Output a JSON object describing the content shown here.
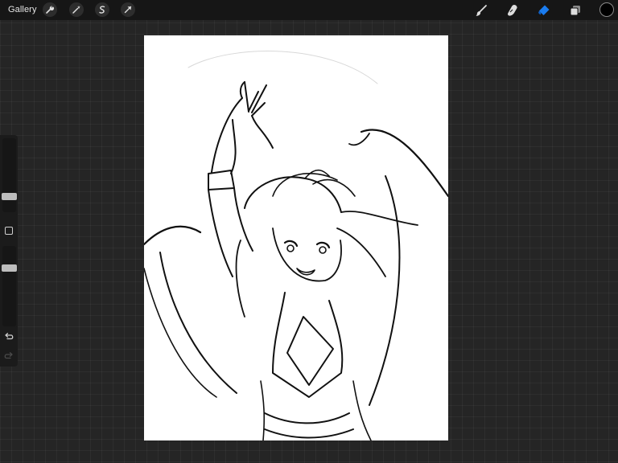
{
  "topbar": {
    "gallery_label": "Gallery",
    "left_tools": [
      {
        "icon": "wrench-icon",
        "name": "actions-button"
      },
      {
        "icon": "magic-wand-icon",
        "name": "adjustments-button"
      },
      {
        "icon": "selection-s-icon",
        "name": "selection-button"
      },
      {
        "icon": "transform-arrow-icon",
        "name": "transform-button"
      }
    ],
    "right_tools": [
      {
        "icon": "brush-icon",
        "name": "brush-tool-button",
        "active": false
      },
      {
        "icon": "smudge-icon",
        "name": "smudge-tool-button",
        "active": false
      },
      {
        "icon": "eraser-icon",
        "name": "eraser-tool-button",
        "active": true
      },
      {
        "icon": "layers-icon",
        "name": "layers-button",
        "active": false
      }
    ],
    "current_color": "#000000",
    "active_color": "#1a7cf0"
  },
  "sidebar": {
    "brush_size_level": 0.5,
    "opacity_level": 0.75,
    "modify_icon": "square-icon",
    "undo_icon": "undo-icon",
    "redo_icon": "redo-icon"
  },
  "colors": {
    "background": "#252525",
    "topbar": "#161616",
    "canvas": "#ffffff",
    "ink": "#111111"
  }
}
